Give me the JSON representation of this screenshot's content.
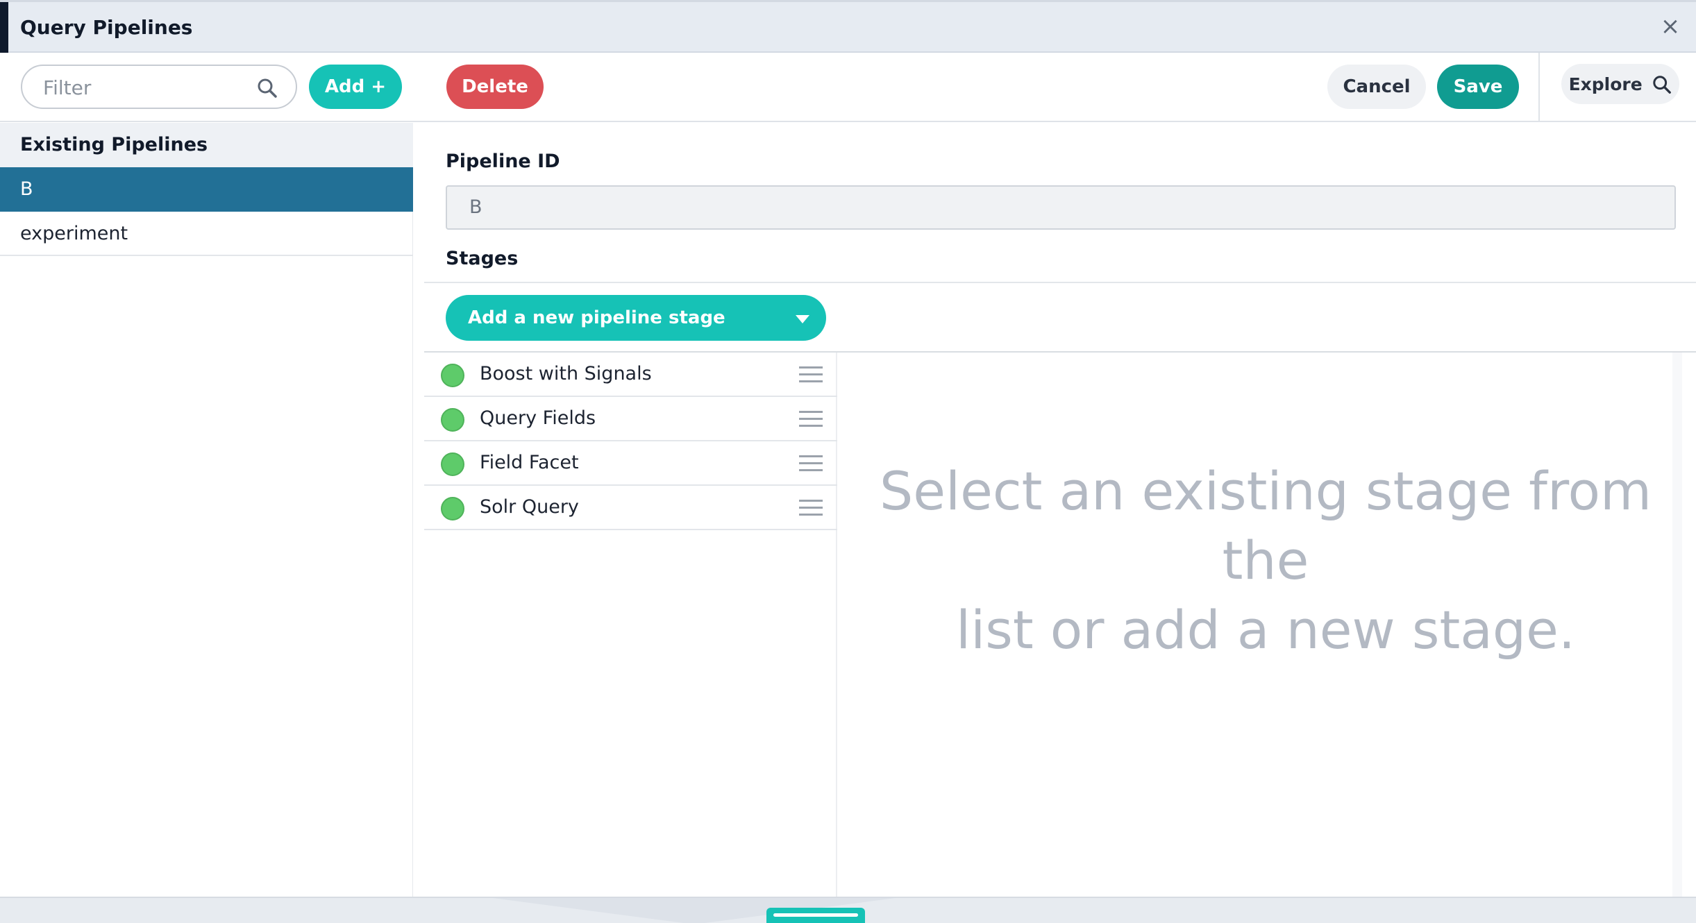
{
  "window": {
    "title": "Query Pipelines",
    "close_glyph": "×"
  },
  "toolbar": {
    "filter_placeholder": "Filter",
    "add_label": "Add +",
    "delete_label": "Delete",
    "cancel_label": "Cancel",
    "save_label": "Save",
    "explore_label": "Explore"
  },
  "sidebar": {
    "heading": "Existing Pipelines",
    "items": [
      {
        "label": "B",
        "selected": true
      },
      {
        "label": "experiment",
        "selected": false
      }
    ]
  },
  "main": {
    "pipeline_id_label": "Pipeline ID",
    "pipeline_id_value": "B",
    "stages_label": "Stages",
    "add_stage_label": "Add a new pipeline stage",
    "stages": [
      {
        "name": "Boost with Signals",
        "status": "enabled"
      },
      {
        "name": "Query Fields",
        "status": "enabled"
      },
      {
        "name": "Field Facet",
        "status": "enabled"
      },
      {
        "name": "Solr Query",
        "status": "enabled"
      }
    ],
    "empty_message_line1": "Select an existing stage from the",
    "empty_message_line2": "list or add a new stage."
  },
  "colors": {
    "accent_teal": "#16c2b6",
    "save_teal": "#109c91",
    "delete_red": "#dc4f55",
    "selected_row": "#227096",
    "status_green": "#5ecb6a"
  },
  "icons": {
    "filter": "search-icon",
    "explore": "search-icon",
    "close": "close-icon",
    "stage_status": "status-dot-icon",
    "stage_drag": "drag-handle-icon",
    "dropdown": "caret-down-icon"
  }
}
